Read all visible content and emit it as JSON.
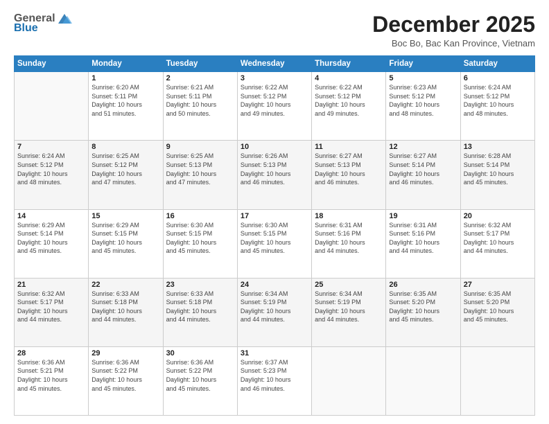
{
  "logo": {
    "general": "General",
    "blue": "Blue"
  },
  "header": {
    "month": "December 2025",
    "location": "Boc Bo, Bac Kan Province, Vietnam"
  },
  "weekdays": [
    "Sunday",
    "Monday",
    "Tuesday",
    "Wednesday",
    "Thursday",
    "Friday",
    "Saturday"
  ],
  "weeks": [
    [
      {
        "day": "",
        "info": ""
      },
      {
        "day": "1",
        "info": "Sunrise: 6:20 AM\nSunset: 5:11 PM\nDaylight: 10 hours\nand 51 minutes."
      },
      {
        "day": "2",
        "info": "Sunrise: 6:21 AM\nSunset: 5:11 PM\nDaylight: 10 hours\nand 50 minutes."
      },
      {
        "day": "3",
        "info": "Sunrise: 6:22 AM\nSunset: 5:12 PM\nDaylight: 10 hours\nand 49 minutes."
      },
      {
        "day": "4",
        "info": "Sunrise: 6:22 AM\nSunset: 5:12 PM\nDaylight: 10 hours\nand 49 minutes."
      },
      {
        "day": "5",
        "info": "Sunrise: 6:23 AM\nSunset: 5:12 PM\nDaylight: 10 hours\nand 48 minutes."
      },
      {
        "day": "6",
        "info": "Sunrise: 6:24 AM\nSunset: 5:12 PM\nDaylight: 10 hours\nand 48 minutes."
      }
    ],
    [
      {
        "day": "7",
        "info": "Sunrise: 6:24 AM\nSunset: 5:12 PM\nDaylight: 10 hours\nand 48 minutes."
      },
      {
        "day": "8",
        "info": "Sunrise: 6:25 AM\nSunset: 5:12 PM\nDaylight: 10 hours\nand 47 minutes."
      },
      {
        "day": "9",
        "info": "Sunrise: 6:25 AM\nSunset: 5:13 PM\nDaylight: 10 hours\nand 47 minutes."
      },
      {
        "day": "10",
        "info": "Sunrise: 6:26 AM\nSunset: 5:13 PM\nDaylight: 10 hours\nand 46 minutes."
      },
      {
        "day": "11",
        "info": "Sunrise: 6:27 AM\nSunset: 5:13 PM\nDaylight: 10 hours\nand 46 minutes."
      },
      {
        "day": "12",
        "info": "Sunrise: 6:27 AM\nSunset: 5:14 PM\nDaylight: 10 hours\nand 46 minutes."
      },
      {
        "day": "13",
        "info": "Sunrise: 6:28 AM\nSunset: 5:14 PM\nDaylight: 10 hours\nand 45 minutes."
      }
    ],
    [
      {
        "day": "14",
        "info": "Sunrise: 6:29 AM\nSunset: 5:14 PM\nDaylight: 10 hours\nand 45 minutes."
      },
      {
        "day": "15",
        "info": "Sunrise: 6:29 AM\nSunset: 5:15 PM\nDaylight: 10 hours\nand 45 minutes."
      },
      {
        "day": "16",
        "info": "Sunrise: 6:30 AM\nSunset: 5:15 PM\nDaylight: 10 hours\nand 45 minutes."
      },
      {
        "day": "17",
        "info": "Sunrise: 6:30 AM\nSunset: 5:15 PM\nDaylight: 10 hours\nand 45 minutes."
      },
      {
        "day": "18",
        "info": "Sunrise: 6:31 AM\nSunset: 5:16 PM\nDaylight: 10 hours\nand 44 minutes."
      },
      {
        "day": "19",
        "info": "Sunrise: 6:31 AM\nSunset: 5:16 PM\nDaylight: 10 hours\nand 44 minutes."
      },
      {
        "day": "20",
        "info": "Sunrise: 6:32 AM\nSunset: 5:17 PM\nDaylight: 10 hours\nand 44 minutes."
      }
    ],
    [
      {
        "day": "21",
        "info": "Sunrise: 6:32 AM\nSunset: 5:17 PM\nDaylight: 10 hours\nand 44 minutes."
      },
      {
        "day": "22",
        "info": "Sunrise: 6:33 AM\nSunset: 5:18 PM\nDaylight: 10 hours\nand 44 minutes."
      },
      {
        "day": "23",
        "info": "Sunrise: 6:33 AM\nSunset: 5:18 PM\nDaylight: 10 hours\nand 44 minutes."
      },
      {
        "day": "24",
        "info": "Sunrise: 6:34 AM\nSunset: 5:19 PM\nDaylight: 10 hours\nand 44 minutes."
      },
      {
        "day": "25",
        "info": "Sunrise: 6:34 AM\nSunset: 5:19 PM\nDaylight: 10 hours\nand 44 minutes."
      },
      {
        "day": "26",
        "info": "Sunrise: 6:35 AM\nSunset: 5:20 PM\nDaylight: 10 hours\nand 45 minutes."
      },
      {
        "day": "27",
        "info": "Sunrise: 6:35 AM\nSunset: 5:20 PM\nDaylight: 10 hours\nand 45 minutes."
      }
    ],
    [
      {
        "day": "28",
        "info": "Sunrise: 6:36 AM\nSunset: 5:21 PM\nDaylight: 10 hours\nand 45 minutes."
      },
      {
        "day": "29",
        "info": "Sunrise: 6:36 AM\nSunset: 5:22 PM\nDaylight: 10 hours\nand 45 minutes."
      },
      {
        "day": "30",
        "info": "Sunrise: 6:36 AM\nSunset: 5:22 PM\nDaylight: 10 hours\nand 45 minutes."
      },
      {
        "day": "31",
        "info": "Sunrise: 6:37 AM\nSunset: 5:23 PM\nDaylight: 10 hours\nand 46 minutes."
      },
      {
        "day": "",
        "info": ""
      },
      {
        "day": "",
        "info": ""
      },
      {
        "day": "",
        "info": ""
      }
    ]
  ]
}
